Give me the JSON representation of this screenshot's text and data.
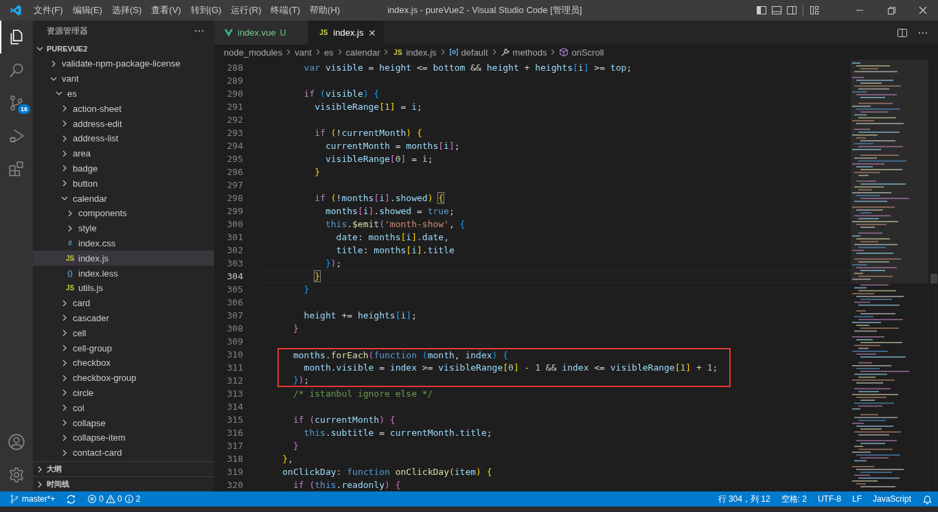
{
  "window": {
    "title": "index.js - pureVue2 - Visual Studio Code [管理员]"
  },
  "menu": [
    "文件(F)",
    "编辑(E)",
    "选择(S)",
    "查看(V)",
    "转到(G)",
    "运行(R)",
    "终端(T)",
    "帮助(H)"
  ],
  "activity_bar": [
    {
      "kind": "explorer",
      "selected": true
    },
    {
      "kind": "search",
      "selected": false
    },
    {
      "kind": "source-control",
      "selected": false,
      "badge": "16"
    },
    {
      "kind": "run",
      "selected": false
    },
    {
      "kind": "extensions",
      "selected": false
    }
  ],
  "activity_bar_bottom": [
    {
      "kind": "account"
    },
    {
      "kind": "settings"
    }
  ],
  "sidebar": {
    "title": "资源管理器",
    "folder": "PUREVUE2",
    "tree": [
      {
        "label": "validate-npm-package-license",
        "kind": "folder",
        "expanded": false,
        "selected": false
      },
      {
        "label": "vant",
        "kind": "folder",
        "expanded": true,
        "selected": false,
        "children": [
          {
            "label": "es",
            "kind": "folder",
            "expanded": true,
            "selected": false,
            "children": [
              {
                "label": "action-sheet",
                "kind": "folder",
                "expanded": false,
                "selected": false
              },
              {
                "label": "address-edit",
                "kind": "folder",
                "expanded": false,
                "selected": false
              },
              {
                "label": "address-list",
                "kind": "folder",
                "expanded": false,
                "selected": false
              },
              {
                "label": "area",
                "kind": "folder",
                "expanded": false,
                "selected": false
              },
              {
                "label": "badge",
                "kind": "folder",
                "expanded": false,
                "selected": false
              },
              {
                "label": "button",
                "kind": "folder",
                "expanded": false,
                "selected": false
              },
              {
                "label": "calendar",
                "kind": "folder",
                "expanded": true,
                "selected": false,
                "children": [
                  {
                    "label": "components",
                    "kind": "folder",
                    "expanded": false,
                    "selected": false
                  },
                  {
                    "label": "style",
                    "kind": "folder",
                    "expanded": false,
                    "selected": false
                  },
                  {
                    "label": "index.css",
                    "kind": "css",
                    "icon_text": "#",
                    "selected": false
                  },
                  {
                    "label": "index.js",
                    "kind": "js",
                    "icon_text": "JS",
                    "selected": true
                  },
                  {
                    "label": "index.less",
                    "kind": "less",
                    "icon_text": "{}",
                    "selected": false
                  },
                  {
                    "label": "utils.js",
                    "kind": "js",
                    "icon_text": "JS",
                    "selected": false
                  }
                ]
              },
              {
                "label": "card",
                "kind": "folder",
                "expanded": false,
                "selected": false
              },
              {
                "label": "cascader",
                "kind": "folder",
                "expanded": false,
                "selected": false
              },
              {
                "label": "cell",
                "kind": "folder",
                "expanded": false,
                "selected": false
              },
              {
                "label": "cell-group",
                "kind": "folder",
                "expanded": false,
                "selected": false
              },
              {
                "label": "checkbox",
                "kind": "folder",
                "expanded": false,
                "selected": false
              },
              {
                "label": "checkbox-group",
                "kind": "folder",
                "expanded": false,
                "selected": false
              },
              {
                "label": "circle",
                "kind": "folder",
                "expanded": false,
                "selected": false
              },
              {
                "label": "col",
                "kind": "folder",
                "expanded": false,
                "selected": false
              },
              {
                "label": "collapse",
                "kind": "folder",
                "expanded": false,
                "selected": false
              },
              {
                "label": "collapse-item",
                "kind": "folder",
                "expanded": false,
                "selected": false
              },
              {
                "label": "contact-card",
                "kind": "folder",
                "expanded": false,
                "selected": false
              }
            ]
          }
        ]
      }
    ],
    "panels": [
      {
        "label": "大纲",
        "expanded": false
      },
      {
        "label": "时间线",
        "expanded": false
      }
    ]
  },
  "tabs": [
    {
      "label": "index.vue",
      "kind": "vue",
      "status": "U",
      "selected": false
    },
    {
      "label": "index.js",
      "kind": "js",
      "icon_text": "JS",
      "selected": true
    }
  ],
  "breadcrumb": [
    {
      "label": "node_modules",
      "kind": "folder"
    },
    {
      "label": "vant",
      "kind": "folder"
    },
    {
      "label": "es",
      "kind": "folder"
    },
    {
      "label": "calendar",
      "kind": "folder"
    },
    {
      "label": "index.js",
      "kind": "js",
      "icon_text": "JS"
    },
    {
      "label": "default",
      "kind": "module"
    },
    {
      "label": "methods",
      "kind": "wrench"
    },
    {
      "label": "onScroll",
      "kind": "method"
    }
  ],
  "editor": {
    "lines": [
      {
        "number": "288",
        "current": false,
        "boxed": false,
        "tokens": [
          {
            "kind": "keyword",
            "text": "var"
          },
          {
            "kind": "variable",
            "text": " visible"
          },
          {
            "kind": "punctuation",
            "text": " = "
          },
          {
            "kind": "variable",
            "text": "height"
          },
          {
            "kind": "punctuation",
            "text": " <= "
          },
          {
            "kind": "variable",
            "text": "bottom"
          },
          {
            "kind": "punctuation",
            "text": " && "
          },
          {
            "kind": "variable",
            "text": "height"
          },
          {
            "kind": "punctuation",
            "text": " + "
          },
          {
            "kind": "variable",
            "text": "heights"
          },
          {
            "kind": "bracket-3",
            "text": "["
          },
          {
            "kind": "variable",
            "text": "i"
          },
          {
            "kind": "bracket-3",
            "text": "]"
          },
          {
            "kind": "punctuation",
            "text": " >= "
          },
          {
            "kind": "variable",
            "text": "top"
          },
          {
            "kind": "punctuation",
            "text": ";"
          }
        ]
      },
      {
        "number": "289",
        "current": false,
        "boxed": false
      },
      {
        "number": "290",
        "current": false,
        "boxed": false,
        "tokens": [
          {
            "kind": "control",
            "text": "if"
          },
          {
            "kind": "bracket-3",
            "text": " ("
          },
          {
            "kind": "variable",
            "text": "visible"
          },
          {
            "kind": "bracket-3",
            "text": ")"
          },
          {
            "kind": "bracket-3",
            "text": " {"
          }
        ]
      },
      {
        "number": "291",
        "current": false,
        "boxed": false,
        "tokens": [
          {
            "kind": "variable",
            "text": "visibleRange"
          },
          {
            "kind": "bracket-1",
            "text": "["
          },
          {
            "kind": "number",
            "text": "1"
          },
          {
            "kind": "bracket-1",
            "text": "]"
          },
          {
            "kind": "punctuation",
            "text": " = "
          },
          {
            "kind": "variable",
            "text": "i"
          },
          {
            "kind": "punctuation",
            "text": ";"
          }
        ]
      },
      {
        "number": "292",
        "current": false,
        "boxed": false
      },
      {
        "number": "293",
        "current": false,
        "boxed": false,
        "tokens": [
          {
            "kind": "control",
            "text": "if"
          },
          {
            "kind": "bracket-1",
            "text": " ("
          },
          {
            "kind": "punctuation",
            "text": "!"
          },
          {
            "kind": "variable",
            "text": "currentMonth"
          },
          {
            "kind": "bracket-1",
            "text": ")"
          },
          {
            "kind": "bracket-1",
            "text": " {"
          }
        ]
      },
      {
        "number": "294",
        "current": false,
        "boxed": false,
        "tokens": [
          {
            "kind": "variable",
            "text": "currentMonth"
          },
          {
            "kind": "punctuation",
            "text": " = "
          },
          {
            "kind": "variable",
            "text": "months"
          },
          {
            "kind": "bracket-2",
            "text": "["
          },
          {
            "kind": "variable",
            "text": "i"
          },
          {
            "kind": "bracket-2",
            "text": "]"
          },
          {
            "kind": "punctuation",
            "text": ";"
          }
        ]
      },
      {
        "number": "295",
        "current": false,
        "boxed": false,
        "tokens": [
          {
            "kind": "variable",
            "text": "visibleRange"
          },
          {
            "kind": "bracket-2",
            "text": "["
          },
          {
            "kind": "number",
            "text": "0"
          },
          {
            "kind": "bracket-2",
            "text": "]"
          },
          {
            "kind": "punctuation",
            "text": " = "
          },
          {
            "kind": "variable",
            "text": "i"
          },
          {
            "kind": "punctuation",
            "text": ";"
          }
        ]
      },
      {
        "number": "296",
        "current": false,
        "boxed": false,
        "tokens": [
          {
            "kind": "bracket-1",
            "text": "}"
          }
        ]
      },
      {
        "number": "297",
        "current": false,
        "boxed": false
      },
      {
        "number": "298",
        "current": false,
        "boxed": false,
        "tokens": [
          {
            "kind": "control",
            "text": "if"
          },
          {
            "kind": "bracket-1",
            "text": " ("
          },
          {
            "kind": "punctuation",
            "text": "!"
          },
          {
            "kind": "variable",
            "text": "months"
          },
          {
            "kind": "bracket-2",
            "text": "["
          },
          {
            "kind": "variable",
            "text": "i"
          },
          {
            "kind": "bracket-2",
            "text": "]"
          },
          {
            "kind": "punctuation",
            "text": "."
          },
          {
            "kind": "variable",
            "text": "showed"
          },
          {
            "kind": "bracket-1",
            "text": ") "
          },
          {
            "kind": "bracket-1-matched",
            "text": "{"
          }
        ]
      },
      {
        "number": "299",
        "current": false,
        "boxed": false,
        "tokens": [
          {
            "kind": "variable",
            "text": "months"
          },
          {
            "kind": "bracket-2",
            "text": "["
          },
          {
            "kind": "variable",
            "text": "i"
          },
          {
            "kind": "bracket-2",
            "text": "]"
          },
          {
            "kind": "punctuation",
            "text": "."
          },
          {
            "kind": "variable",
            "text": "showed"
          },
          {
            "kind": "punctuation",
            "text": " = "
          },
          {
            "kind": "keyword",
            "text": "true"
          },
          {
            "kind": "punctuation",
            "text": ";"
          }
        ]
      },
      {
        "number": "300",
        "current": false,
        "boxed": false,
        "tokens": [
          {
            "kind": "keyword",
            "text": "this"
          },
          {
            "kind": "function",
            "text": ".$emit"
          },
          {
            "kind": "bracket-2",
            "text": "("
          },
          {
            "kind": "string",
            "text": "'month-show'"
          },
          {
            "kind": "punctuation",
            "text": ", "
          },
          {
            "kind": "bracket-3",
            "text": "{"
          }
        ]
      },
      {
        "number": "301",
        "current": false,
        "boxed": false,
        "tokens": [
          {
            "kind": "variable",
            "text": "date"
          },
          {
            "kind": "punctuation",
            "text": ": "
          },
          {
            "kind": "variable",
            "text": "months"
          },
          {
            "kind": "bracket-1",
            "text": "["
          },
          {
            "kind": "variable",
            "text": "i"
          },
          {
            "kind": "bracket-1",
            "text": "]"
          },
          {
            "kind": "variable",
            "text": ".date"
          },
          {
            "kind": "punctuation",
            "text": ","
          }
        ]
      },
      {
        "number": "302",
        "current": false,
        "boxed": false,
        "tokens": [
          {
            "kind": "variable",
            "text": "title"
          },
          {
            "kind": "punctuation",
            "text": ": "
          },
          {
            "kind": "variable",
            "text": "months"
          },
          {
            "kind": "bracket-1",
            "text": "["
          },
          {
            "kind": "variable",
            "text": "i"
          },
          {
            "kind": "bracket-1",
            "text": "]"
          },
          {
            "kind": "variable",
            "text": ".title"
          }
        ]
      },
      {
        "number": "303",
        "current": false,
        "boxed": false,
        "tokens": [
          {
            "kind": "bracket-3",
            "text": "}"
          },
          {
            "kind": "bracket-2",
            "text": ")"
          },
          {
            "kind": "punctuation",
            "text": ";"
          }
        ]
      },
      {
        "number": "304",
        "current": true,
        "boxed": false,
        "tokens": [
          {
            "kind": "bracket-1-matched",
            "text": "}"
          }
        ]
      },
      {
        "number": "305",
        "current": false,
        "boxed": false,
        "tokens": [
          {
            "kind": "bracket-3",
            "text": "}"
          }
        ]
      },
      {
        "number": "306",
        "current": false,
        "boxed": false
      },
      {
        "number": "307",
        "current": false,
        "boxed": false,
        "tokens": [
          {
            "kind": "variable",
            "text": "height"
          },
          {
            "kind": "punctuation",
            "text": " += "
          },
          {
            "kind": "variable",
            "text": "heights"
          },
          {
            "kind": "bracket-3",
            "text": "["
          },
          {
            "kind": "variable",
            "text": "i"
          },
          {
            "kind": "bracket-3",
            "text": "]"
          },
          {
            "kind": "punctuation",
            "text": ";"
          }
        ]
      },
      {
        "number": "308",
        "current": false,
        "boxed": false,
        "tokens": [
          {
            "kind": "bracket-2",
            "text": "}"
          }
        ]
      },
      {
        "number": "309",
        "current": false,
        "boxed": false
      },
      {
        "number": "310",
        "current": false,
        "boxed": true,
        "tokens": [
          {
            "kind": "variable",
            "text": "months"
          },
          {
            "kind": "function",
            "text": ".forEach"
          },
          {
            "kind": "bracket-2",
            "text": "("
          },
          {
            "kind": "keyword",
            "text": "function"
          },
          {
            "kind": "bracket-3",
            "text": " ("
          },
          {
            "kind": "variable",
            "text": "month"
          },
          {
            "kind": "punctuation",
            "text": ", "
          },
          {
            "kind": "variable",
            "text": "index"
          },
          {
            "kind": "bracket-3",
            "text": ")"
          },
          {
            "kind": "bracket-3",
            "text": " {"
          }
        ]
      },
      {
        "number": "311",
        "current": false,
        "boxed": true,
        "tokens": [
          {
            "kind": "variable",
            "text": "month.visible"
          },
          {
            "kind": "punctuation",
            "text": " = "
          },
          {
            "kind": "variable",
            "text": "index"
          },
          {
            "kind": "punctuation",
            "text": " >= "
          },
          {
            "kind": "variable",
            "text": "visibleRange"
          },
          {
            "kind": "bracket-1",
            "text": "["
          },
          {
            "kind": "number",
            "text": "0"
          },
          {
            "kind": "bracket-1",
            "text": "]"
          },
          {
            "kind": "punctuation",
            "text": " - "
          },
          {
            "kind": "number",
            "text": "1"
          },
          {
            "kind": "punctuation",
            "text": " && "
          },
          {
            "kind": "variable",
            "text": "index"
          },
          {
            "kind": "punctuation",
            "text": " <= "
          },
          {
            "kind": "variable",
            "text": "visibleRange"
          },
          {
            "kind": "bracket-1",
            "text": "["
          },
          {
            "kind": "number",
            "text": "1"
          },
          {
            "kind": "bracket-1",
            "text": "]"
          },
          {
            "kind": "punctuation",
            "text": " + "
          },
          {
            "kind": "number",
            "text": "1"
          },
          {
            "kind": "punctuation",
            "text": ";"
          }
        ]
      },
      {
        "number": "312",
        "current": false,
        "boxed": true,
        "tokens": [
          {
            "kind": "bracket-3",
            "text": "}"
          },
          {
            "kind": "bracket-2",
            "text": ")"
          },
          {
            "kind": "punctuation",
            "text": ";"
          }
        ]
      },
      {
        "number": "313",
        "current": false,
        "boxed": false,
        "tokens": [
          {
            "kind": "comment",
            "text": "/* istanbul ignore else */"
          }
        ]
      },
      {
        "number": "314",
        "current": false,
        "boxed": false
      },
      {
        "number": "315",
        "current": false,
        "boxed": false,
        "tokens": [
          {
            "kind": "control",
            "text": "if"
          },
          {
            "kind": "bracket-2",
            "text": " ("
          },
          {
            "kind": "variable",
            "text": "currentMonth"
          },
          {
            "kind": "bracket-2",
            "text": ")"
          },
          {
            "kind": "bracket-2",
            "text": " {"
          }
        ]
      },
      {
        "number": "316",
        "current": false,
        "boxed": false,
        "tokens": [
          {
            "kind": "keyword",
            "text": "this"
          },
          {
            "kind": "variable",
            "text": ".subtitle"
          },
          {
            "kind": "punctuation",
            "text": " = "
          },
          {
            "kind": "variable",
            "text": "currentMonth.title"
          },
          {
            "kind": "punctuation",
            "text": ";"
          }
        ]
      },
      {
        "number": "317",
        "current": false,
        "boxed": false,
        "tokens": [
          {
            "kind": "bracket-2",
            "text": "}"
          }
        ]
      },
      {
        "number": "318",
        "current": false,
        "boxed": false,
        "tokens": [
          {
            "kind": "bracket-1",
            "text": "}"
          },
          {
            "kind": "punctuation",
            "text": ","
          }
        ]
      },
      {
        "number": "319",
        "current": false,
        "boxed": false,
        "tokens": [
          {
            "kind": "variable",
            "text": "onClickDay"
          },
          {
            "kind": "punctuation",
            "text": ": "
          },
          {
            "kind": "keyword",
            "text": "function"
          },
          {
            "kind": "function",
            "text": " onClickDay"
          },
          {
            "kind": "bracket-1",
            "text": "("
          },
          {
            "kind": "variable",
            "text": "item"
          },
          {
            "kind": "bracket-1",
            "text": ")"
          },
          {
            "kind": "bracket-1",
            "text": " {"
          }
        ]
      },
      {
        "number": "320",
        "current": false,
        "boxed": false,
        "tokens": [
          {
            "kind": "control",
            "text": "if"
          },
          {
            "kind": "bracket-2",
            "text": " ("
          },
          {
            "kind": "keyword",
            "text": "this"
          },
          {
            "kind": "variable",
            "text": ".readonly"
          },
          {
            "kind": "bracket-2",
            "text": ")"
          },
          {
            "kind": "bracket-2",
            "text": " {"
          }
        ]
      }
    ]
  },
  "status_bar": {
    "branch": "master*+",
    "errors": "0",
    "warnings": "0",
    "infos": "2",
    "right": [
      "行 304，列 12",
      "空格: 2",
      "UTF-8",
      "LF",
      "JavaScript"
    ]
  }
}
